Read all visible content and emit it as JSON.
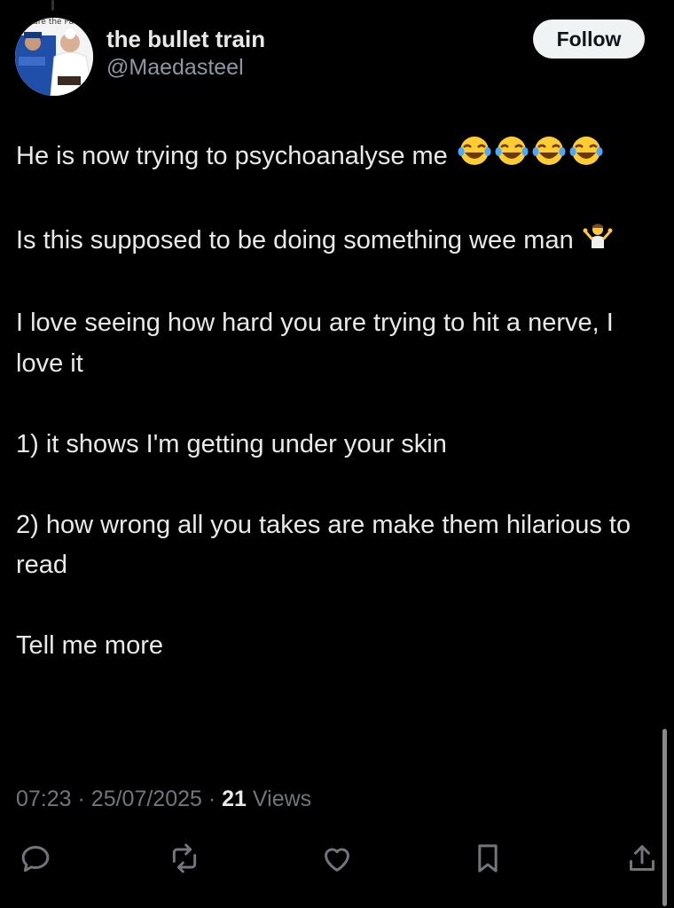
{
  "tweet": {
    "author": {
      "display_name": "the bullet train",
      "handle": "@Maedasteel",
      "avatar_caption": "e are the Pa"
    },
    "follow_label": "Follow",
    "lines": {
      "l1": "He is now trying to psychoanalyse me",
      "l2": "Is this supposed to be doing something wee man",
      "l3": "I love seeing how hard you are trying to hit a nerve, I love it",
      "l4": "1) it shows I'm getting under your skin",
      "l5": "2) how wrong all you takes are make them hilarious to read",
      "l6": "Tell me more"
    },
    "emojis": {
      "laughing": "face-with-tears-of-joy-icon",
      "shrug": "person-shrugging-icon"
    },
    "time": "07:23",
    "date": "25/07/2025",
    "separator": "·",
    "views_count": "21",
    "views_label": "Views"
  },
  "actions": [
    "reply-icon",
    "repost-icon",
    "like-icon",
    "bookmark-icon",
    "share-icon"
  ],
  "colors": {
    "background": "#000000",
    "text": "#e7e9ea",
    "muted": "#71767b",
    "follow_bg": "#eff3f4"
  }
}
